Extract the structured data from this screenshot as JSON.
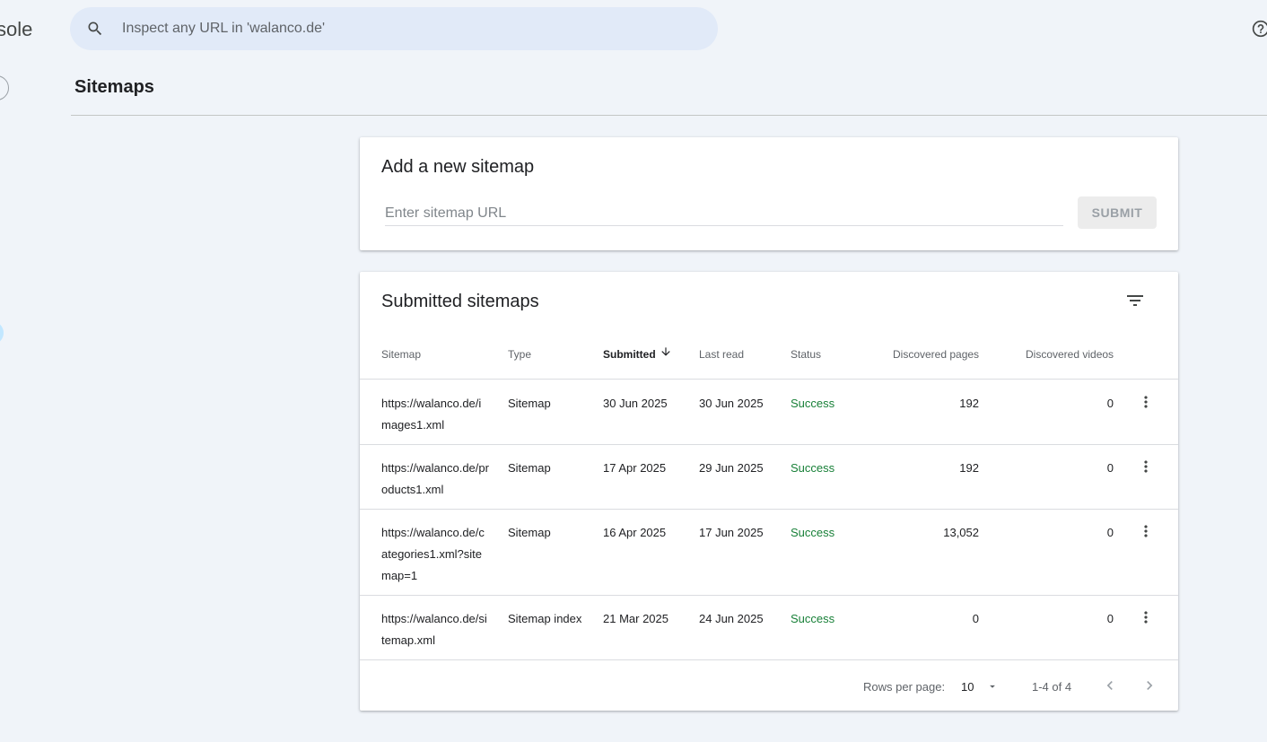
{
  "app": {
    "brand_text": "sole"
  },
  "search": {
    "placeholder": "Inspect any URL in 'walanco.de'"
  },
  "page": {
    "title": "Sitemaps"
  },
  "add_sitemap": {
    "title": "Add a new sitemap",
    "input_placeholder": "Enter sitemap URL",
    "submit_label": "SUBMIT"
  },
  "submitted": {
    "title": "Submitted sitemaps",
    "columns": {
      "sitemap": "Sitemap",
      "type": "Type",
      "submitted": "Submitted",
      "last_read": "Last read",
      "status": "Status",
      "discovered_pages": "Discovered pages",
      "discovered_videos": "Discovered videos"
    },
    "rows": [
      {
        "sitemap": "https://walanco.de/images1.xml",
        "type": "Sitemap",
        "submitted": "30 Jun 2025",
        "last_read": "30 Jun 2025",
        "status": "Success",
        "pages": "192",
        "videos": "0"
      },
      {
        "sitemap": "https://walanco.de/products1.xml",
        "type": "Sitemap",
        "submitted": "17 Apr 2025",
        "last_read": "29 Jun 2025",
        "status": "Success",
        "pages": "192",
        "videos": "0"
      },
      {
        "sitemap": "https://walanco.de/categories1.xml?sitemap=1",
        "type": "Sitemap",
        "submitted": "16 Apr 2025",
        "last_read": "17 Jun 2025",
        "status": "Success",
        "pages": "13,052",
        "videos": "0"
      },
      {
        "sitemap": "https://walanco.de/sitemap.xml",
        "type": "Sitemap index",
        "submitted": "21 Mar 2025",
        "last_read": "24 Jun 2025",
        "status": "Success",
        "pages": "0",
        "videos": "0"
      }
    ],
    "pagination": {
      "rows_per_page_label": "Rows per page:",
      "rows_per_page_value": "10",
      "range": "1-4 of 4"
    }
  },
  "colors": {
    "success": "#188038",
    "background": "#f0f4f9",
    "search_bg": "#e1eaf8"
  }
}
